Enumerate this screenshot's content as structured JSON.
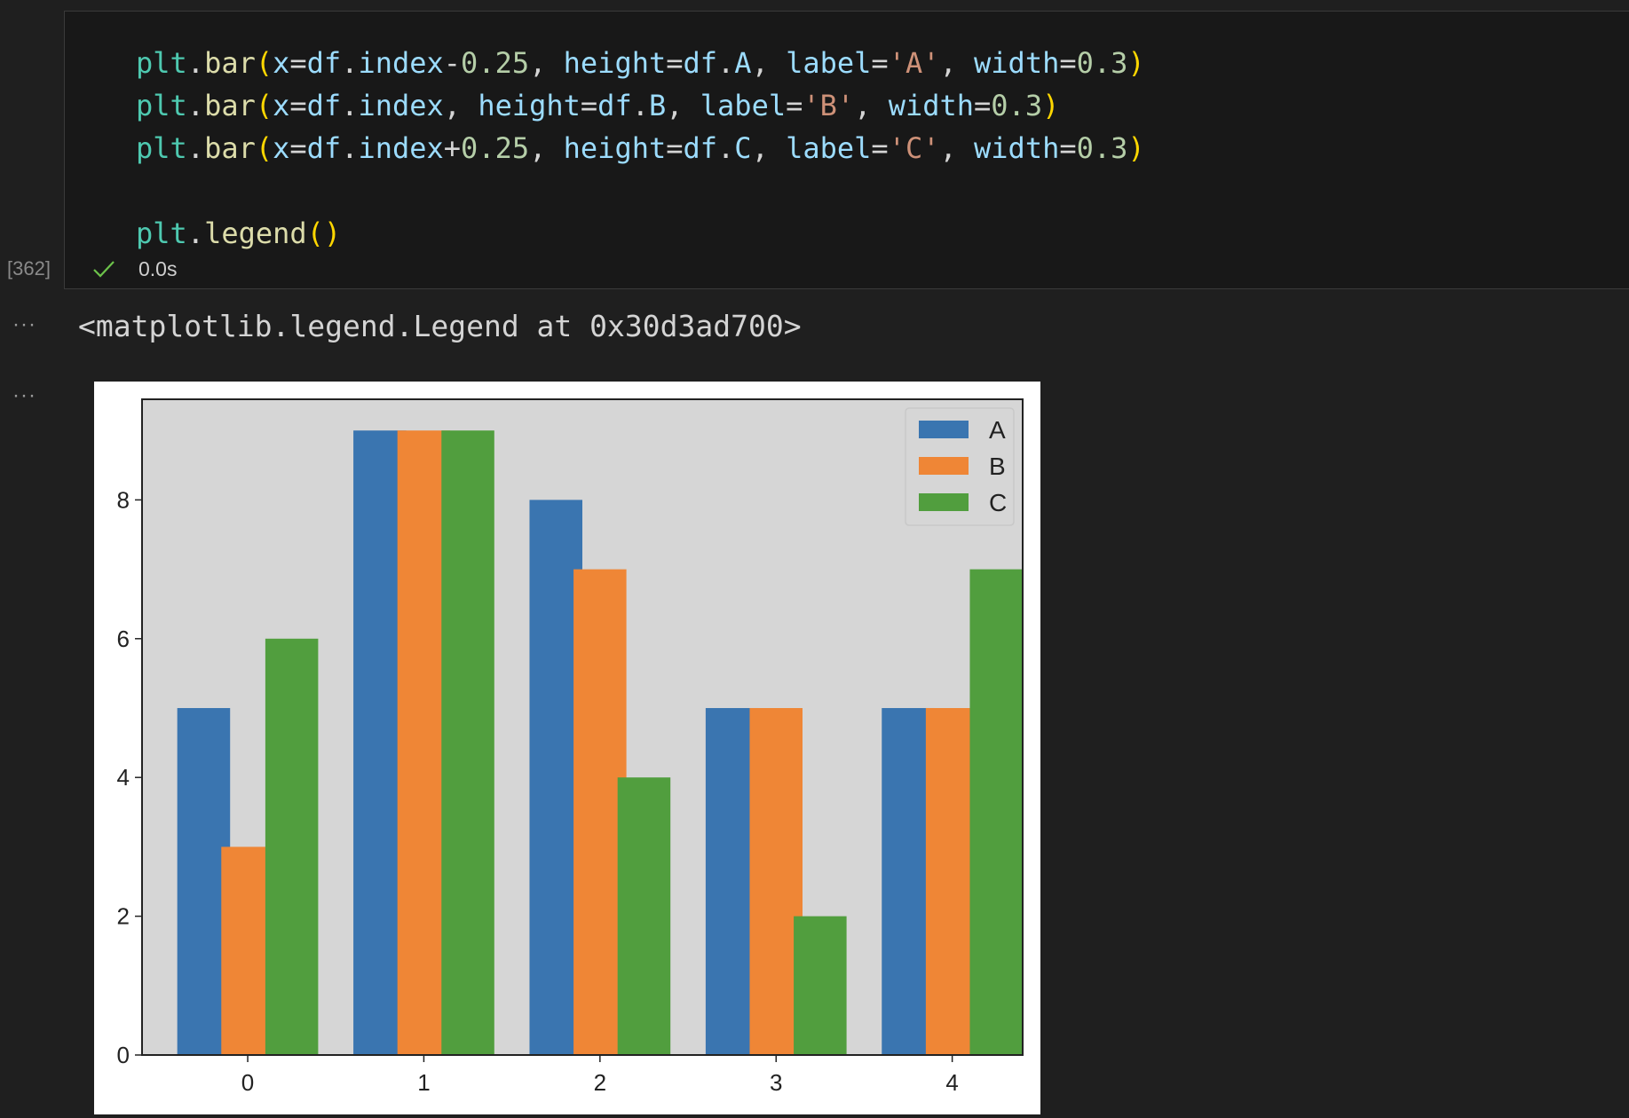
{
  "code_cell": {
    "lines": [
      [
        [
          "plt",
          "mod"
        ],
        [
          ".",
          "punc"
        ],
        [
          "bar",
          "fn"
        ],
        [
          "(",
          "paren"
        ],
        [
          "x",
          "var"
        ],
        [
          "=",
          "punc"
        ],
        [
          "df",
          "var"
        ],
        [
          ".",
          "punc"
        ],
        [
          "index",
          "var"
        ],
        [
          "-",
          "punc"
        ],
        [
          "0.25",
          "num"
        ],
        [
          ", ",
          "punc"
        ],
        [
          "height",
          "var"
        ],
        [
          "=",
          "punc"
        ],
        [
          "df",
          "var"
        ],
        [
          ".",
          "punc"
        ],
        [
          "A",
          "var"
        ],
        [
          ", ",
          "punc"
        ],
        [
          "label",
          "var"
        ],
        [
          "=",
          "punc"
        ],
        [
          "'A'",
          "str"
        ],
        [
          ", ",
          "punc"
        ],
        [
          "width",
          "var"
        ],
        [
          "=",
          "punc"
        ],
        [
          "0.3",
          "num"
        ],
        [
          ")",
          "paren"
        ]
      ],
      [
        [
          "plt",
          "mod"
        ],
        [
          ".",
          "punc"
        ],
        [
          "bar",
          "fn"
        ],
        [
          "(",
          "paren"
        ],
        [
          "x",
          "var"
        ],
        [
          "=",
          "punc"
        ],
        [
          "df",
          "var"
        ],
        [
          ".",
          "punc"
        ],
        [
          "index",
          "var"
        ],
        [
          ", ",
          "punc"
        ],
        [
          "height",
          "var"
        ],
        [
          "=",
          "punc"
        ],
        [
          "df",
          "var"
        ],
        [
          ".",
          "punc"
        ],
        [
          "B",
          "var"
        ],
        [
          ", ",
          "punc"
        ],
        [
          "label",
          "var"
        ],
        [
          "=",
          "punc"
        ],
        [
          "'B'",
          "str"
        ],
        [
          ", ",
          "punc"
        ],
        [
          "width",
          "var"
        ],
        [
          "=",
          "punc"
        ],
        [
          "0.3",
          "num"
        ],
        [
          ")",
          "paren"
        ]
      ],
      [
        [
          "plt",
          "mod"
        ],
        [
          ".",
          "punc"
        ],
        [
          "bar",
          "fn"
        ],
        [
          "(",
          "paren"
        ],
        [
          "x",
          "var"
        ],
        [
          "=",
          "punc"
        ],
        [
          "df",
          "var"
        ],
        [
          ".",
          "punc"
        ],
        [
          "index",
          "var"
        ],
        [
          "+",
          "punc"
        ],
        [
          "0.25",
          "num"
        ],
        [
          ", ",
          "punc"
        ],
        [
          "height",
          "var"
        ],
        [
          "=",
          "punc"
        ],
        [
          "df",
          "var"
        ],
        [
          ".",
          "punc"
        ],
        [
          "C",
          "var"
        ],
        [
          ", ",
          "punc"
        ],
        [
          "label",
          "var"
        ],
        [
          "=",
          "punc"
        ],
        [
          "'C'",
          "str"
        ],
        [
          ", ",
          "punc"
        ],
        [
          "width",
          "var"
        ],
        [
          "=",
          "punc"
        ],
        [
          "0.3",
          "num"
        ],
        [
          ")",
          "paren"
        ]
      ],
      [],
      [
        [
          "plt",
          "mod"
        ],
        [
          ".",
          "punc"
        ],
        [
          "legend",
          "fn"
        ],
        [
          "()",
          "paren"
        ]
      ]
    ],
    "execution_count": "[362]",
    "status_icon": "check-icon",
    "exec_time": "0.0s"
  },
  "output": {
    "ellipsis": "···",
    "text": "<matplotlib.legend.Legend at 0x30d3ad700>"
  },
  "chart_data": {
    "type": "bar",
    "categories": [
      "0",
      "1",
      "2",
      "3",
      "4"
    ],
    "x": [
      0,
      1,
      2,
      3,
      4
    ],
    "series": [
      {
        "name": "A",
        "offset": -0.25,
        "values": [
          5,
          9,
          8,
          5,
          5
        ],
        "color": "#3a75b0"
      },
      {
        "name": "B",
        "offset": 0,
        "values": [
          3,
          9,
          7,
          5,
          5
        ],
        "color": "#ef8636"
      },
      {
        "name": "C",
        "offset": 0.25,
        "values": [
          6,
          9,
          4,
          2,
          7
        ],
        "color": "#519e3e"
      }
    ],
    "bar_width": 0.3,
    "xlim": [
      -0.6,
      4.4
    ],
    "ylim": [
      0,
      9.45
    ],
    "yticks": [
      0,
      2,
      4,
      6,
      8
    ],
    "xticks": [
      0,
      1,
      2,
      3,
      4
    ],
    "legend": "upper right",
    "plot_background": "#d6d6d6",
    "grid": false,
    "title": "",
    "xlabel": "",
    "ylabel": ""
  }
}
